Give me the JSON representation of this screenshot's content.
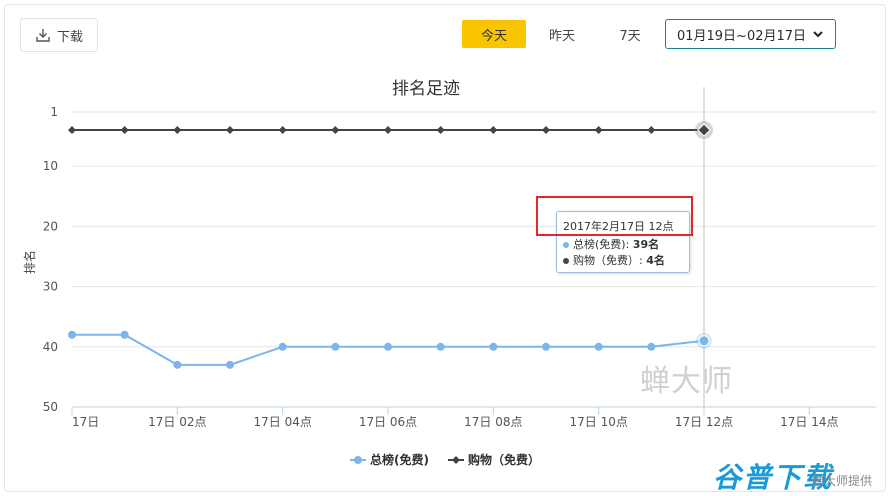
{
  "toolbar": {
    "download_label": "下载",
    "period_tabs": [
      "今天",
      "昨天",
      "7天"
    ],
    "active_tab": "今天",
    "date_range": "01月19日~02月17日"
  },
  "tooltip": {
    "title": "2017年2月17日 12点",
    "rows": [
      {
        "label": "总榜(免费)",
        "value": "39名",
        "color": "#7cb5ec"
      },
      {
        "label": "购物（免费）",
        "value": "4名",
        "color": "#434348"
      }
    ]
  },
  "watermarks": {
    "main": "蝉大师",
    "logo": "谷普下载",
    "credit": "蝉大师提供"
  },
  "chart_data": {
    "type": "line",
    "title": "排名足迹",
    "ylabel": "排名",
    "xlabel": "",
    "y_reversed": true,
    "ylim": [
      1,
      50
    ],
    "yticks": [
      1,
      10,
      20,
      30,
      40,
      50
    ],
    "x": [
      "17日 00点",
      "17日 01点",
      "17日 02点",
      "17日 03点",
      "17日 04点",
      "17日 05点",
      "17日 06点",
      "17日 07点",
      "17日 08点",
      "17日 09点",
      "17日 10点",
      "17日 11点",
      "17日 12点"
    ],
    "xtick_labels": [
      "17日",
      "17日 02点",
      "17日 04点",
      "17日 06点",
      "17日 08点",
      "17日 10点",
      "17日 12点",
      "17日 14点"
    ],
    "series": [
      {
        "name": "总榜(免费)",
        "color": "#7cb5ec",
        "marker": "circle",
        "values": [
          38,
          38,
          43,
          43,
          40,
          40,
          40,
          40,
          40,
          40,
          40,
          40,
          39
        ]
      },
      {
        "name": "购物（免费）",
        "color": "#434348",
        "marker": "diamond",
        "values": [
          4,
          4,
          4,
          4,
          4,
          4,
          4,
          4,
          4,
          4,
          4,
          4,
          4
        ]
      }
    ],
    "grid": true,
    "legend": "bottom-center",
    "highlighted_index": 12
  }
}
